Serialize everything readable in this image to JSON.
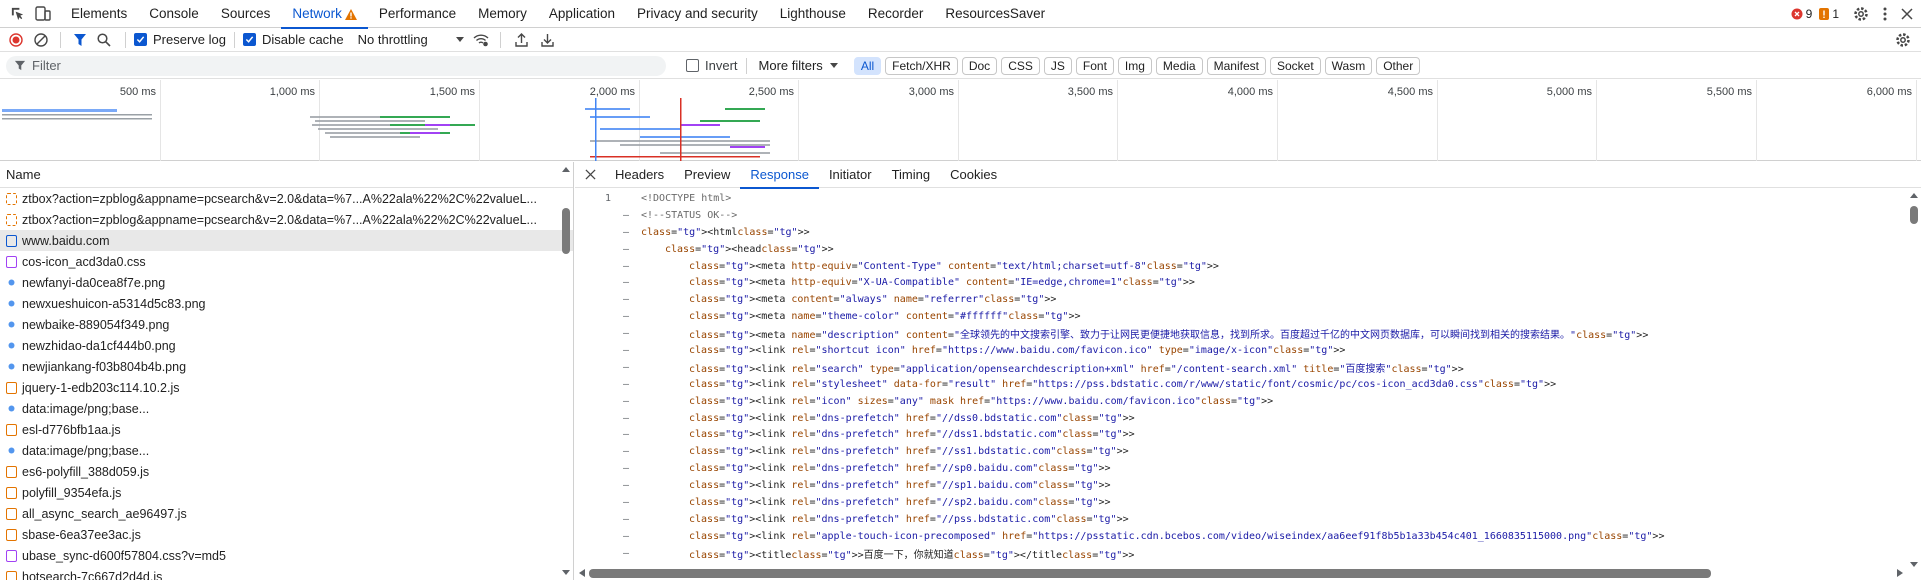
{
  "top_tabs": [
    "Elements",
    "Console",
    "Sources",
    "Network",
    "Performance",
    "Memory",
    "Application",
    "Privacy and security",
    "Lighthouse",
    "Recorder",
    "ResourcesSaver"
  ],
  "active_tab": "Network",
  "errors_count": "9",
  "warnings_count": "1",
  "netbar": {
    "preserve_log": "Preserve log",
    "disable_cache": "Disable cache",
    "throttling": "No throttling"
  },
  "filter": {
    "placeholder": "Filter",
    "invert": "Invert",
    "more_filters": "More filters",
    "types": [
      "All",
      "Fetch/XHR",
      "Doc",
      "CSS",
      "JS",
      "Font",
      "Img",
      "Media",
      "Manifest",
      "Socket",
      "Wasm",
      "Other"
    ]
  },
  "overview": {
    "ticks": [
      "500 ms",
      "1,000 ms",
      "1,500 ms",
      "2,000 ms",
      "2,500 ms",
      "3,000 ms",
      "3,500 ms",
      "4,000 ms",
      "4,500 ms",
      "5,000 ms",
      "5,500 ms",
      "6,000 ms"
    ]
  },
  "list": {
    "header": "Name",
    "items": [
      {
        "name": "ztbox?action=zpblog&appname=pcsearch&v=2.0&data=%7...A%22ala%22%2C%22valueL...",
        "type": "xhr"
      },
      {
        "name": "ztbox?action=zpblog&appname=pcsearch&v=2.0&data=%7...A%22ala%22%2C%22valueL...",
        "type": "xhr"
      },
      {
        "name": "www.baidu.com",
        "type": "doc"
      },
      {
        "name": "cos-icon_acd3da0.css",
        "type": "css"
      },
      {
        "name": "newfanyi-da0cea8f7e.png",
        "type": "img"
      },
      {
        "name": "newxueshuicon-a5314d5c83.png",
        "type": "img"
      },
      {
        "name": "newbaike-889054f349.png",
        "type": "img"
      },
      {
        "name": "newzhidao-da1cf444b0.png",
        "type": "img"
      },
      {
        "name": "newjiankang-f03b804b4b.png",
        "type": "img"
      },
      {
        "name": "jquery-1-edb203c114.10.2.js",
        "type": "js"
      },
      {
        "name": "data:image/png;base...",
        "type": "img"
      },
      {
        "name": "esl-d776bfb1aa.js",
        "type": "js"
      },
      {
        "name": "data:image/png;base...",
        "type": "img"
      },
      {
        "name": "es6-polyfill_388d059.js",
        "type": "js"
      },
      {
        "name": "polyfill_9354efa.js",
        "type": "js"
      },
      {
        "name": "all_async_search_ae96497.js",
        "type": "js"
      },
      {
        "name": "sbase-6ea37ee3ac.js",
        "type": "js"
      },
      {
        "name": "ubase_sync-d600f57804.css?v=md5",
        "type": "css"
      },
      {
        "name": "hotsearch-7c667d2d4d.js",
        "type": "js"
      }
    ]
  },
  "detail_tabs": [
    "Headers",
    "Preview",
    "Response",
    "Initiator",
    "Timing",
    "Cookies"
  ],
  "active_detail_tab": "Response",
  "code": {
    "line_number": "1",
    "lines": [
      "<!DOCTYPE html>",
      "<!--STATUS OK-->",
      "<html>",
      "<head>",
      "<meta http-equiv=\"Content-Type\" content=\"text/html;charset=utf-8\">",
      "<meta http-equiv=\"X-UA-Compatible\" content=\"IE=edge,chrome=1\">",
      "<meta content=\"always\" name=\"referrer\">",
      "<meta name=\"theme-color\" content=\"#ffffff\">",
      "<meta name=\"description\" content=\"全球领先的中文搜索引擎、致力于让网民更便捷地获取信息，找到所求。百度超过千亿的中文网页数据库，可以瞬间找到相关的搜索结果。\">",
      "<link rel=\"shortcut icon\" href=\"https://www.baidu.com/favicon.ico\" type=\"image/x-icon\">",
      "<link rel=\"search\" type=\"application/opensearchdescription+xml\" href=\"/content-search.xml\" title=\"百度搜索\">",
      "<link rel=\"stylesheet\" data-for=\"result\" href=\"https://pss.bdstatic.com/r/www/static/font/cosmic/pc/cos-icon_acd3da0.css\">",
      "<link rel=\"icon\" sizes=\"any\" mask href=\"https://www.baidu.com/favicon.ico\">",
      "<link rel=\"dns-prefetch\" href=\"//dss0.bdstatic.com\">",
      "<link rel=\"dns-prefetch\" href=\"//dss1.bdstatic.com\">",
      "<link rel=\"dns-prefetch\" href=\"//ss1.bdstatic.com\">",
      "<link rel=\"dns-prefetch\" href=\"//sp0.baidu.com\">",
      "<link rel=\"dns-prefetch\" href=\"//sp1.baidu.com\">",
      "<link rel=\"dns-prefetch\" href=\"//sp2.baidu.com\">",
      "<link rel=\"dns-prefetch\" href=\"//pss.bdstatic.com\">",
      "<link rel=\"apple-touch-icon-precomposed\" href=\"https://psstatic.cdn.bcebos.com/video/wiseindex/aa6eef91f8b5b1a33b454c401_1660835115000.png\">",
      "<title>百度一下，你就知道</title>"
    ]
  },
  "colors": {
    "accent": "#0b57d0",
    "error": "#dc362e",
    "warning": "#e37400"
  }
}
